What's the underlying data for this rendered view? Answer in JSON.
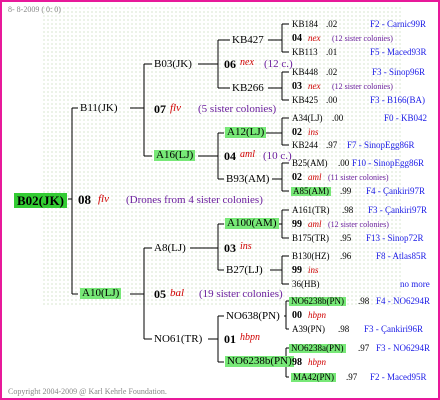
{
  "header": {
    "date_text": "8- 8-2009 ( 0: 0)"
  },
  "footer": {
    "copyright": "Copyright 2004-2009 @ Karl Kehrle Foundation."
  },
  "colors": {
    "border": "#e8199a",
    "highlight": "#77e877",
    "link_blue": "#1a1ae6",
    "italic_red": "#d00000",
    "sister_purple": "#6b1f9e"
  },
  "root": {
    "id": "B02(JK)",
    "year": "08",
    "race": "flv",
    "note": "(Drones from 4 sister colonies)"
  },
  "gen1": {
    "father": {
      "id": "B11(JK)",
      "year": "07",
      "race": "flv",
      "note": "(5 sister colonies)"
    },
    "mother": {
      "id": "A10(LJ)",
      "year": "05",
      "race": "bal",
      "note": "(19 sister colonies)"
    }
  },
  "gen2": {
    "ff": {
      "id": "B03(JK)",
      "year": "06",
      "race": "nex",
      "note": "(12 c.)"
    },
    "fm": {
      "id": "A16(LJ)",
      "year": "04",
      "race": "aml",
      "note": "(10 c.)"
    },
    "mf": {
      "id": "A8(LJ)",
      "year": "03",
      "race": "ins"
    },
    "mm": {
      "id": "NO61(TR)",
      "year": "01",
      "race": "hbpn"
    }
  },
  "gen3": {
    "fff": {
      "id": "KB427"
    },
    "ffm": {
      "id": "KB266"
    },
    "fmf": {
      "id": "A12(LJ)"
    },
    "fmm": {
      "id": "B93(AM)"
    },
    "mff": {
      "id": "A100(AM)"
    },
    "mfm": {
      "id": "B27(LJ)"
    },
    "mmf": {
      "id": "NO638(PN)"
    },
    "mmm": {
      "id": "NO6238b(PN)"
    }
  },
  "gen4": {
    "r1": {
      "id": "KB184",
      "score": ".02",
      "code": "F2 - Carnic99R"
    },
    "r2": {
      "year": "04",
      "race": "nex",
      "note": "(12 sister colonies)"
    },
    "r3": {
      "id": "KB113",
      "score": ".01",
      "code": "F5 - Maced93R"
    },
    "r4": {
      "id": "KB448",
      "score": ".02",
      "code": "F3 - Sinop96R"
    },
    "r5": {
      "year": "03",
      "race": "nex",
      "note": "(12 sister colonies)"
    },
    "r6": {
      "id": "KB425",
      "score": ".00",
      "code": "F3 - B166(BA)"
    },
    "r7": {
      "id": "A34(LJ)",
      "score": ".00",
      "code": "F0 - KB042"
    },
    "r8": {
      "year": "02",
      "race": "ins"
    },
    "r9": {
      "id": "KB244",
      "score": ".97",
      "code": "F7 - SinopEgg86R"
    },
    "r10": {
      "id": "B25(AM)",
      "score": ".00",
      "code": "F10 - SinopEgg86R"
    },
    "r11": {
      "year": "02",
      "race": "aml",
      "note": "(11 sister colonies)"
    },
    "r12": {
      "id": "A85(AM)",
      "score": ".99",
      "code": "F4 - Çankiri97R"
    },
    "r13": {
      "id": "A161(TR)",
      "score": ".98",
      "code": "F3 - Çankiri97R"
    },
    "r14": {
      "year": "99",
      "race": "aml",
      "note": "(12 sister colonies)"
    },
    "r15": {
      "id": "B175(TR)",
      "score": ".95",
      "code": "F13 - Sinop72R"
    },
    "r16": {
      "id": "B130(HZ)",
      "score": ".96",
      "code": "F8 - Atlas85R"
    },
    "r17": {
      "year": "99",
      "race": "ins"
    },
    "r18": {
      "id": "36(HB)",
      "extra": "no more"
    },
    "r19": {
      "id": "NO6238b(PN)",
      "score": ".98",
      "code": "F4 - NO6294R"
    },
    "r20": {
      "year": "00",
      "race": "hbpn"
    },
    "r21": {
      "id": "A39(PN)",
      "score": ".98",
      "code": "F3 - Çankiri96R"
    },
    "r22": {
      "id": "NO6238a(PN)",
      "score": ".97",
      "code": "F3 - NO6294R"
    },
    "r23": {
      "year": "98",
      "race": "hbpn"
    },
    "r24": {
      "id": "MA42(PN)",
      "score": ".97",
      "code": "F2 - Maced95R"
    }
  }
}
